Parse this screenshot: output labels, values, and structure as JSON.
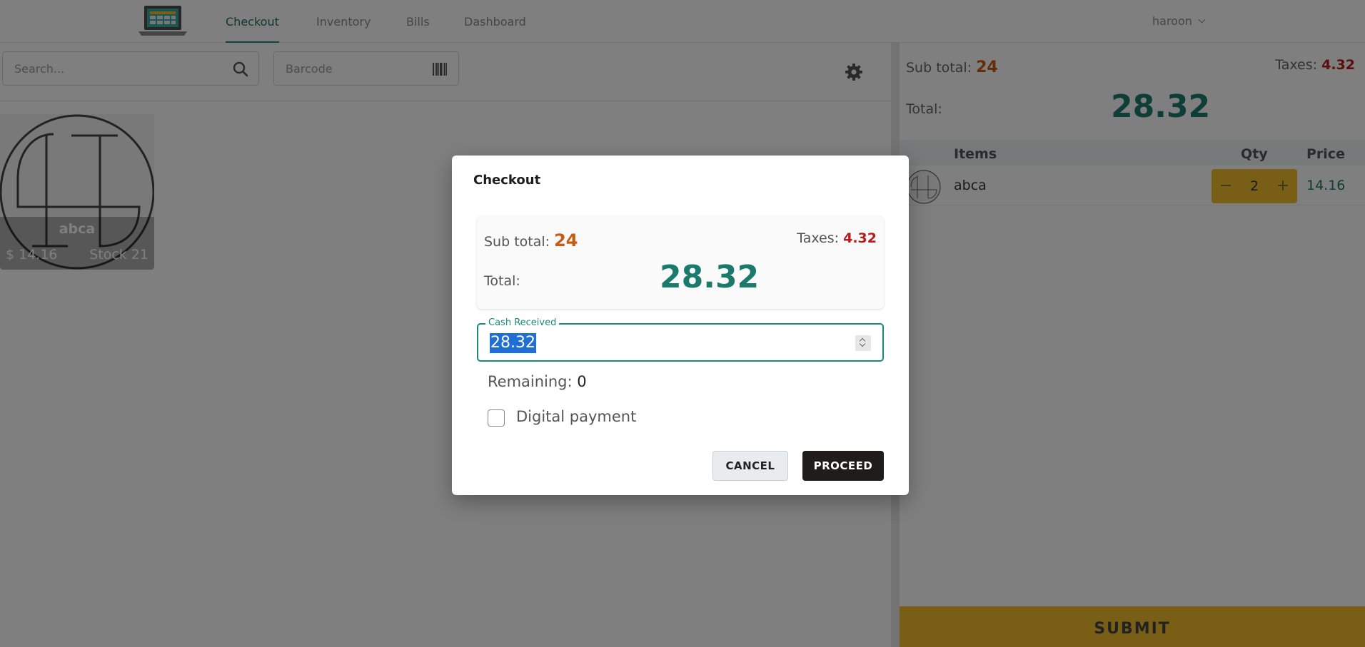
{
  "nav": {
    "tabs": [
      {
        "label": "Checkout",
        "active": true
      },
      {
        "label": "Inventory",
        "active": false
      },
      {
        "label": "Bills",
        "active": false
      },
      {
        "label": "Dashboard",
        "active": false
      }
    ],
    "user": "haroon"
  },
  "toolbar": {
    "search_placeholder": "Search...",
    "barcode_placeholder": "Barcode"
  },
  "products": [
    {
      "name": "abca",
      "price": "$ 14.16",
      "stock": "Stock 21"
    }
  ],
  "cart": {
    "subtotal_label": "Sub total:",
    "subtotal": "24",
    "taxes_label": "Taxes:",
    "taxes": "4.32",
    "total_label": "Total:",
    "total": "28.32",
    "columns": [
      "Items",
      "Qty",
      "Price"
    ],
    "items": [
      {
        "name": "abca",
        "qty": "2",
        "price": "14.16"
      }
    ],
    "minus": "−",
    "plus": "+",
    "submit_label": "SUBMIT"
  },
  "modal": {
    "title": "Checkout",
    "subtotal_label": "Sub total:",
    "subtotal": "24",
    "taxes_label": "Taxes:",
    "taxes": "4.32",
    "total_label": "Total:",
    "total": "28.32",
    "cash_label": "Cash Received",
    "cash_value": "28.32",
    "remaining_label": "Remaining:",
    "remaining": "0",
    "digital_payment_label": "Digital payment",
    "digital_payment_checked": false,
    "cancel_label": "CANCEL",
    "proceed_label": "PROCEED"
  },
  "colors": {
    "accent": "#1a8a7a",
    "subtotal": "#c75b14",
    "taxes": "#b81c1c",
    "total": "#1a7a6c",
    "submit": "#f2bd2c",
    "proceed": "#1f1c1a"
  },
  "icons": [
    "laptop-logo-icon",
    "chevron-down-icon",
    "search-icon",
    "barcode-icon",
    "gear-icon",
    "product-image-icon",
    "spinner-icon",
    "checkbox-icon"
  ]
}
